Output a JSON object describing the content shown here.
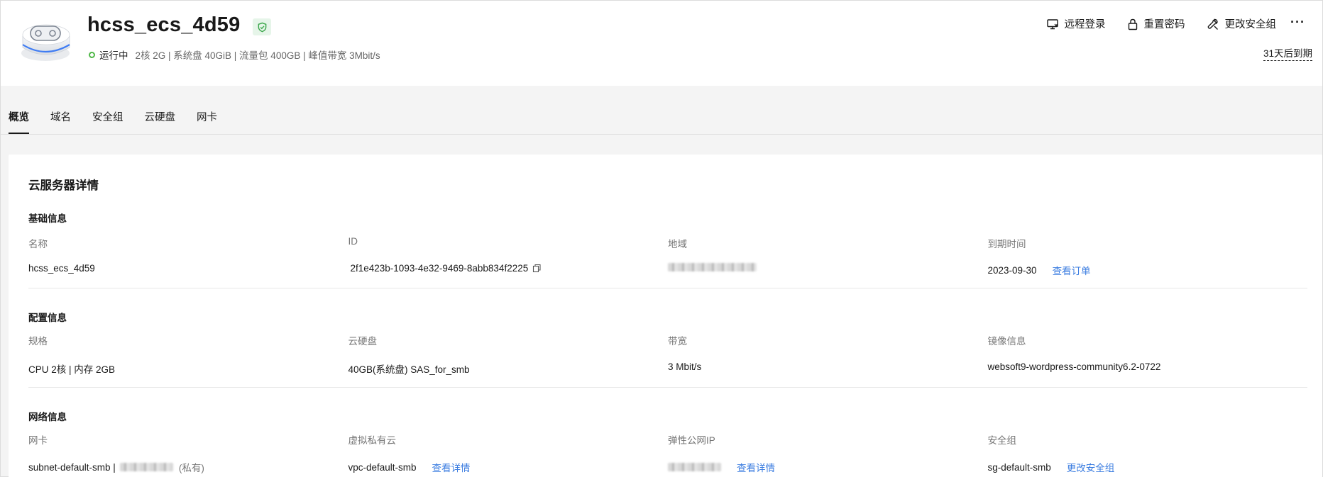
{
  "header": {
    "title": "hcss_ecs_4d59",
    "status": "运行中",
    "specs": "2核  2G | 系统盘 40GiB | 流量包 400GB | 峰值带宽 3Mbit/s",
    "expire_text": "31天后到期",
    "actions": {
      "remote_login": "远程登录",
      "reset_password": "重置密码",
      "change_security_group": "更改安全组",
      "more": "···"
    }
  },
  "tabs": [
    "概览",
    "域名",
    "安全组",
    "云硬盘",
    "网卡"
  ],
  "card": {
    "title": "云服务器详情",
    "basic": {
      "title": "基础信息",
      "name_label": "名称",
      "name_value": "hcss_ecs_4d59",
      "id_label": "ID",
      "id_value": "2f1e423b-1093-4e32-9469-8abb834f2225",
      "region_label": "地域",
      "expire_label": "到期时间",
      "expire_value": "2023-09-30",
      "expire_link": "查看订单"
    },
    "config": {
      "title": "配置信息",
      "spec_label": "规格",
      "spec_value": "CPU 2核 | 内存 2GB",
      "disk_label": "云硬盘",
      "disk_value": "40GB(系统盘) SAS_for_smb",
      "bandwidth_label": "带宽",
      "bandwidth_value": "3 Mbit/s",
      "image_label": "镜像信息",
      "image_value": "websoft9-wordpress-community6.2-0722"
    },
    "network": {
      "title": "网络信息",
      "nic_label": "网卡",
      "nic_value": "subnet-default-smb |",
      "nic_private": "(私有)",
      "vpc_label": "虚拟私有云",
      "vpc_value": "vpc-default-smb",
      "vpc_link": "查看详情",
      "eip_label": "弹性公网IP",
      "eip_link": "查看详情",
      "sg_label": "安全组",
      "sg_value": "sg-default-smb",
      "sg_link": "更改安全组"
    }
  },
  "colors": {
    "status_green": "#50b848",
    "link_blue": "#3a7ce0",
    "shield_green": "#3aa64a"
  }
}
